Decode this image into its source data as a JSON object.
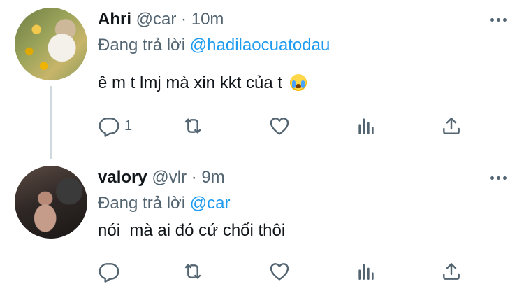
{
  "tweets": [
    {
      "name": "Ahri",
      "handle": "@car",
      "separator": "·",
      "time": "10m",
      "replying_prefix": "Đang trả lời",
      "replying_to": "@hadilaocuatodau",
      "text": "ê m t lmj mà xin kkt của t",
      "emoji": "loudly-crying-face",
      "reply_count": "1"
    },
    {
      "name": "valory",
      "handle": "@vlr",
      "separator": "·",
      "time": "9m",
      "replying_prefix": "Đang trả lời",
      "replying_to": "@car",
      "text": "nói  mà ai đó cứ chối thôi",
      "reply_count": ""
    }
  ],
  "colors": {
    "text": "#0f1419",
    "secondary": "#536471",
    "link": "#1d9bf0",
    "thread_line": "#cfd9de"
  },
  "icons": [
    "reply-icon",
    "retweet-icon",
    "like-icon",
    "views-icon",
    "share-icon",
    "more-icon"
  ]
}
